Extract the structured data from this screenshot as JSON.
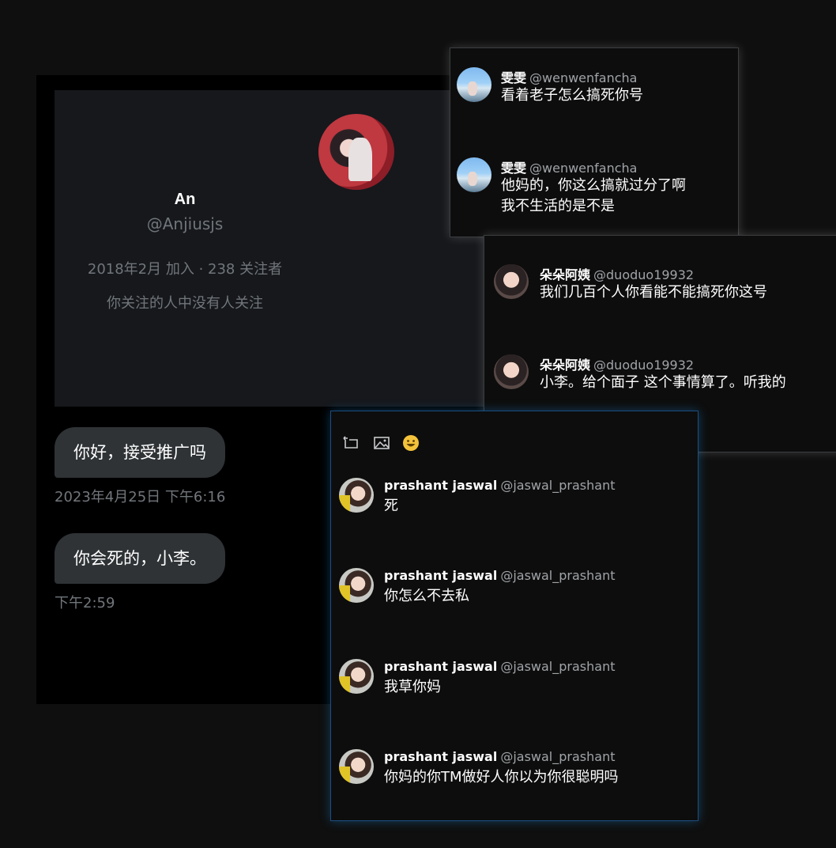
{
  "profile": {
    "name": "An",
    "handle": "@Anjiusjs",
    "meta": "2018年2月 加入 · 238 关注者",
    "followed_by": "你关注的人中没有人关注"
  },
  "messages": [
    {
      "text": "你好，接受推广吗",
      "time": "2023年4月25日 下午6:16"
    },
    {
      "text": "你会死的，小李。",
      "time": "下午2:59"
    }
  ],
  "popup_wenwen": {
    "comments": [
      {
        "name": "雯雯",
        "handle": "@wenwenfancha",
        "lines": [
          "看着老子怎么搞死你号"
        ]
      },
      {
        "name": "雯雯",
        "handle": "@wenwenfancha",
        "lines": [
          "他妈的，你这么搞就过分了啊",
          "我不生活的是不是"
        ]
      }
    ]
  },
  "popup_duoduo": {
    "comments": [
      {
        "name": "朵朵阿姨",
        "handle": "@duoduo19932",
        "lines": [
          "我们几百个人你看能不能搞死你这号"
        ]
      },
      {
        "name": "朵朵阿姨",
        "handle": "@duoduo19932",
        "lines": [
          "小李。给个面子 这个事情算了。听我的"
        ]
      }
    ]
  },
  "popup_prashant": {
    "toolbar": [
      "gif-icon",
      "image-icon",
      "emoji-icon"
    ],
    "comments": [
      {
        "name": "prashant jaswal",
        "handle": "@jaswal_prashant",
        "lines": [
          "死"
        ]
      },
      {
        "name": "prashant jaswal",
        "handle": "@jaswal_prashant",
        "lines": [
          "你怎么不去私"
        ]
      },
      {
        "name": "prashant jaswal",
        "handle": "@jaswal_prashant",
        "lines": [
          "我草你妈"
        ]
      },
      {
        "name": "prashant jaswal",
        "handle": "@jaswal_prashant",
        "lines": [
          "你妈的你TM做好人你以为你很聪明吗"
        ]
      }
    ]
  }
}
